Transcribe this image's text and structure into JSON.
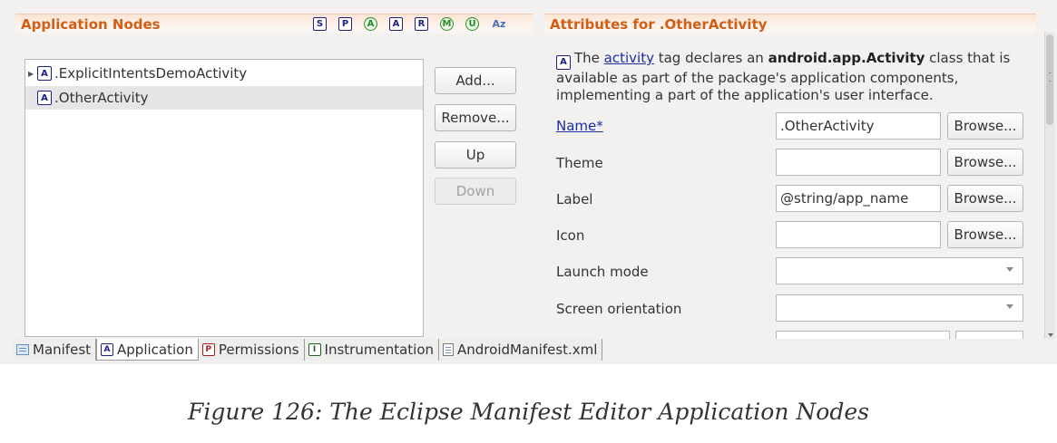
{
  "left_panel": {
    "title": "Application Nodes",
    "filters": [
      "S",
      "P",
      "A",
      "A",
      "R",
      "M",
      "U",
      "Az"
    ],
    "tree": [
      {
        "badge": "A",
        "label": ".ExplicitIntentsDemoActivity",
        "expandable": true,
        "selected": false
      },
      {
        "badge": "A",
        "label": ".OtherActivity",
        "expandable": false,
        "selected": true
      }
    ],
    "buttons": {
      "add": "Add...",
      "remove": "Remove...",
      "up": "Up",
      "down": "Down"
    }
  },
  "right_panel": {
    "title": "Attributes for .OtherActivity",
    "description": {
      "badge": "A",
      "pre": "The ",
      "link": "activity",
      "mid": " tag declares an ",
      "bold": "android.app.Activity",
      "post_line1": " class that is",
      "line2": "available as part of the package's application components,",
      "line3": "implementing a part of the application's user interface."
    },
    "fields": [
      {
        "label": "Name*",
        "value": ".OtherActivity",
        "button": "Browse..."
      },
      {
        "label": "Theme",
        "value": "",
        "button": "Browse..."
      },
      {
        "label": "Label",
        "value": "@string/app_name",
        "button": "Browse..."
      },
      {
        "label": "Icon",
        "value": "",
        "button": "Browse..."
      }
    ],
    "combos": [
      {
        "label": "Launch mode",
        "value": ""
      },
      {
        "label": "Screen orientation",
        "value": ""
      }
    ]
  },
  "tabs": [
    {
      "icon": "manifest-icon",
      "label": "Manifest",
      "active": false
    },
    {
      "icon": "A",
      "label": "Application",
      "active": true
    },
    {
      "icon": "P",
      "label": "Permissions",
      "active": false
    },
    {
      "icon": "I",
      "label": "Instrumentation",
      "active": false
    },
    {
      "icon": "xml-file-icon",
      "label": "AndroidManifest.xml",
      "active": false
    }
  ],
  "caption": "Figure 126: The Eclipse Manifest Editor Application Nodes"
}
